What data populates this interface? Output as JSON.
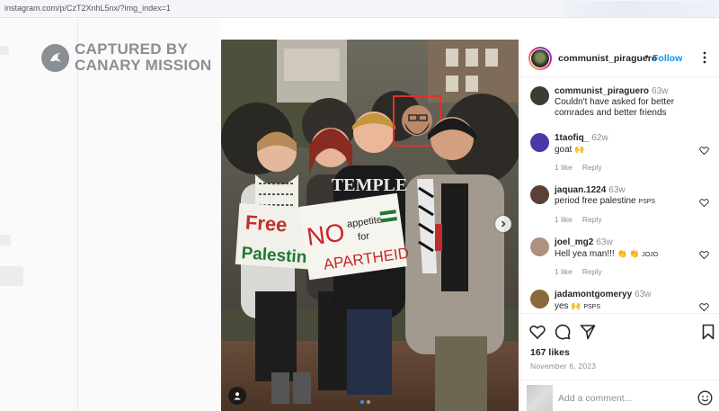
{
  "browser": {
    "url": "instagram.com/p/CzT2XnhL5nx/?img_index=1"
  },
  "watermark": {
    "line1": "CAPTURED BY",
    "line2": "CANARY MISSION"
  },
  "photo": {
    "sign_left": {
      "line1": "Free",
      "line2": "Palestine"
    },
    "sign_right": {
      "no": "NO",
      "appetite": "appetite",
      "for": "for",
      "apartheid": "APARTHEID"
    },
    "shirt_text": "TEMPLE",
    "carousel": {
      "count": 2,
      "active_index": 0
    }
  },
  "post": {
    "header": {
      "username": "communist_piraguero",
      "follow_label": "Follow",
      "separator": "•"
    },
    "comments": [
      {
        "username": "communist_piraguero",
        "time": "63w",
        "text": "Couldn't have asked for better comrades and better friends",
        "avatar_color": "#3a3d30",
        "has_meta": false
      },
      {
        "username": "1taofiq_",
        "time": "62w",
        "text": "goat",
        "emoji": "🙌",
        "likes": "1 like",
        "reply": "Reply",
        "avatar_color": "#4a3aa8",
        "has_meta": true
      },
      {
        "username": "jaquan.1224",
        "time": "63w",
        "text": "period free palestine",
        "suffix": "PSPS",
        "likes": "1 like",
        "reply": "Reply",
        "avatar_color": "#5a4035",
        "has_meta": true
      },
      {
        "username": "joel_mg2",
        "time": "63w",
        "text": "Hell yea man!!!",
        "emoji": "👏 👏",
        "suffix": "JOJO",
        "likes": "1 like",
        "reply": "Reply",
        "avatar_color": "#b09080",
        "has_meta": true
      },
      {
        "username": "jadamontgomeryy",
        "time": "63w",
        "text": "yes",
        "emoji": "🙌",
        "suffix": "PSPS",
        "avatar_color": "#8a6a3a",
        "has_meta": false
      }
    ],
    "likes": "167 likes",
    "date": "November 6, 2023",
    "add_comment_placeholder": "Add a comment..."
  },
  "colors": {
    "link": "#0095f6",
    "muted": "#8e8e8e",
    "text": "#262626",
    "highlight_box": "#e0302a"
  },
  "icons": [
    "canary-logo-icon",
    "chevron-right-icon",
    "user-tag-icon",
    "more-icon",
    "heart-icon",
    "comment-icon",
    "share-icon",
    "bookmark-icon",
    "emoji-icon"
  ]
}
